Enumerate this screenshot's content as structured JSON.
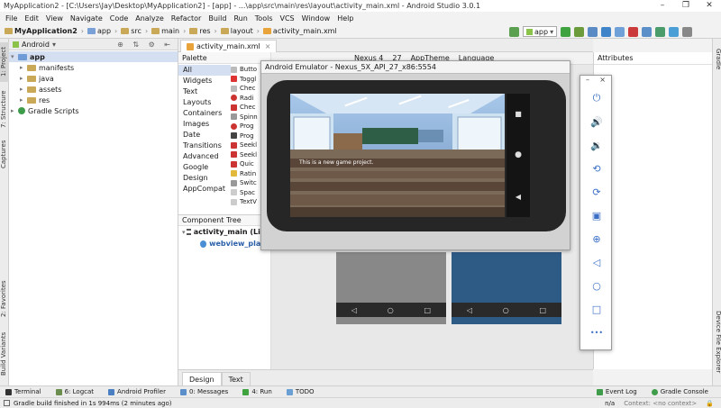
{
  "window": {
    "title": "MyApplication2 - [C:\\Users\\Jay\\Desktop\\MyApplication2] - [app] - ...\\app\\src\\main\\res\\layout\\activity_main.xml - Android Studio 3.0.1",
    "controls": [
      "–",
      "❐",
      "✕"
    ]
  },
  "menu": [
    "File",
    "Edit",
    "View",
    "Navigate",
    "Code",
    "Analyze",
    "Refactor",
    "Build",
    "Run",
    "Tools",
    "VCS",
    "Window",
    "Help"
  ],
  "breadcrumb": [
    "MyApplication2",
    "app",
    "src",
    "main",
    "res",
    "layout",
    "activity_main.xml"
  ],
  "run_config": "app",
  "left_tabs": [
    "1: Project",
    "7: Structure",
    "Captures",
    "2: Favorites",
    "Build Variants"
  ],
  "right_tabs": [
    "Gradle",
    "Device File Explorer"
  ],
  "project_panel": {
    "view": "Android",
    "tree": [
      {
        "label": "app",
        "level": 0,
        "expanded": true,
        "kind": "module"
      },
      {
        "label": "manifests",
        "level": 1,
        "expanded": false,
        "kind": "folder"
      },
      {
        "label": "java",
        "level": 1,
        "expanded": false,
        "kind": "folder"
      },
      {
        "label": "assets",
        "level": 1,
        "expanded": false,
        "kind": "folder"
      },
      {
        "label": "res",
        "level": 1,
        "expanded": false,
        "kind": "folder"
      },
      {
        "label": "Gradle Scripts",
        "level": 0,
        "expanded": false,
        "kind": "gradle"
      }
    ]
  },
  "editor_tab": "activity_main.xml",
  "palette": {
    "title": "Palette",
    "categories": [
      "All",
      "Widgets",
      "Text",
      "Layouts",
      "Containers",
      "Images",
      "Date",
      "Transitions",
      "Advanced",
      "Google",
      "Design",
      "AppCompat"
    ],
    "items": [
      "Butto",
      "Toggl",
      "Chec",
      "Radi",
      "Chec",
      "Spinn",
      "Prog",
      "Prog",
      "Seekl",
      "Seekl",
      "Quic",
      "Ratin",
      "Switc",
      "Spac",
      "TextV"
    ]
  },
  "component_tree": {
    "title": "Component Tree",
    "rows": [
      "activity_main (Line",
      "webview_playg"
    ]
  },
  "design_toolbar": [
    "Nexus 4",
    "27",
    "AppTheme",
    "Language"
  ],
  "attributes_title": "Attributes",
  "design_tabs": [
    "Design",
    "Text"
  ],
  "emulator": {
    "title": "Android Emulator - Nexus_5X_API_27_x86:5554",
    "game_text": "This is a new game project.",
    "side_icons": [
      "power-icon",
      "volume-up-icon",
      "volume-down-icon",
      "rotate-left-icon",
      "rotate-right-icon",
      "camera-icon",
      "zoom-icon",
      "back-icon",
      "home-icon",
      "overview-icon",
      "more-icon"
    ],
    "side_glyphs": [
      "⏻",
      "🔊",
      "🔉",
      "⟲",
      "⟳",
      "▣",
      "⊕",
      "◁",
      "○",
      "□",
      "•••"
    ]
  },
  "tool_windows": [
    "Terminal",
    "6: Logcat",
    "Android Profiler",
    "0: Messages",
    "4: Run",
    "TODO"
  ],
  "tool_windows_right": [
    "Event Log",
    "Gradle Console"
  ],
  "status": {
    "message": "Gradle build finished in 1s 994ms (2 minutes ago)",
    "right": "n/a",
    "context": "Context: <no context>"
  }
}
